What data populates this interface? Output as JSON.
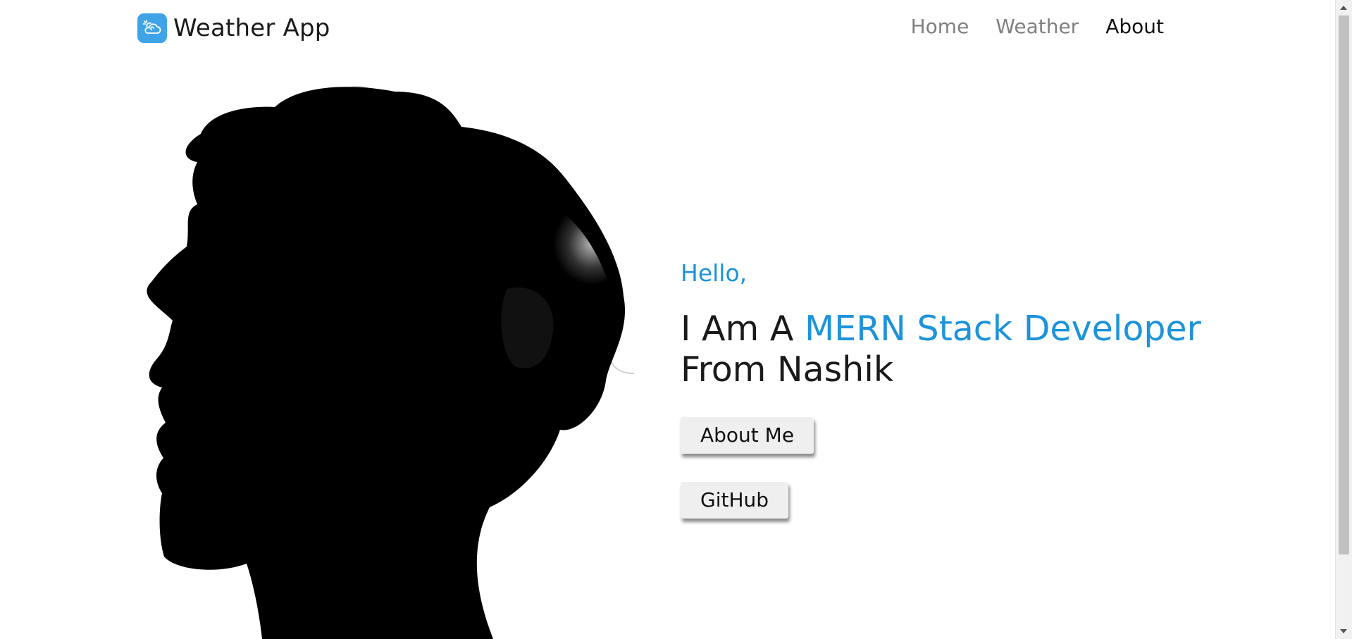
{
  "navbar": {
    "brand_name": "Weather App",
    "brand_icon": "weather-cloud-sun-icon",
    "links": [
      {
        "label": "Home",
        "active": false
      },
      {
        "label": "Weather",
        "active": false
      },
      {
        "label": "About",
        "active": true
      }
    ]
  },
  "hero": {
    "greeting": "Hello,",
    "headline_prefix": "I Am A ",
    "headline_accent": "MERN Stack Developer",
    "headline_suffix": "From Nashik",
    "about_button_label": "About Me",
    "github_button_label": "GitHub",
    "image": "person-head-silhouette"
  },
  "colors": {
    "accent": "#1c93db",
    "brand_icon_bg": "#3fa3e8",
    "nav_inactive": "#808080",
    "nav_active": "#111111",
    "button_bg": "#efefef"
  }
}
